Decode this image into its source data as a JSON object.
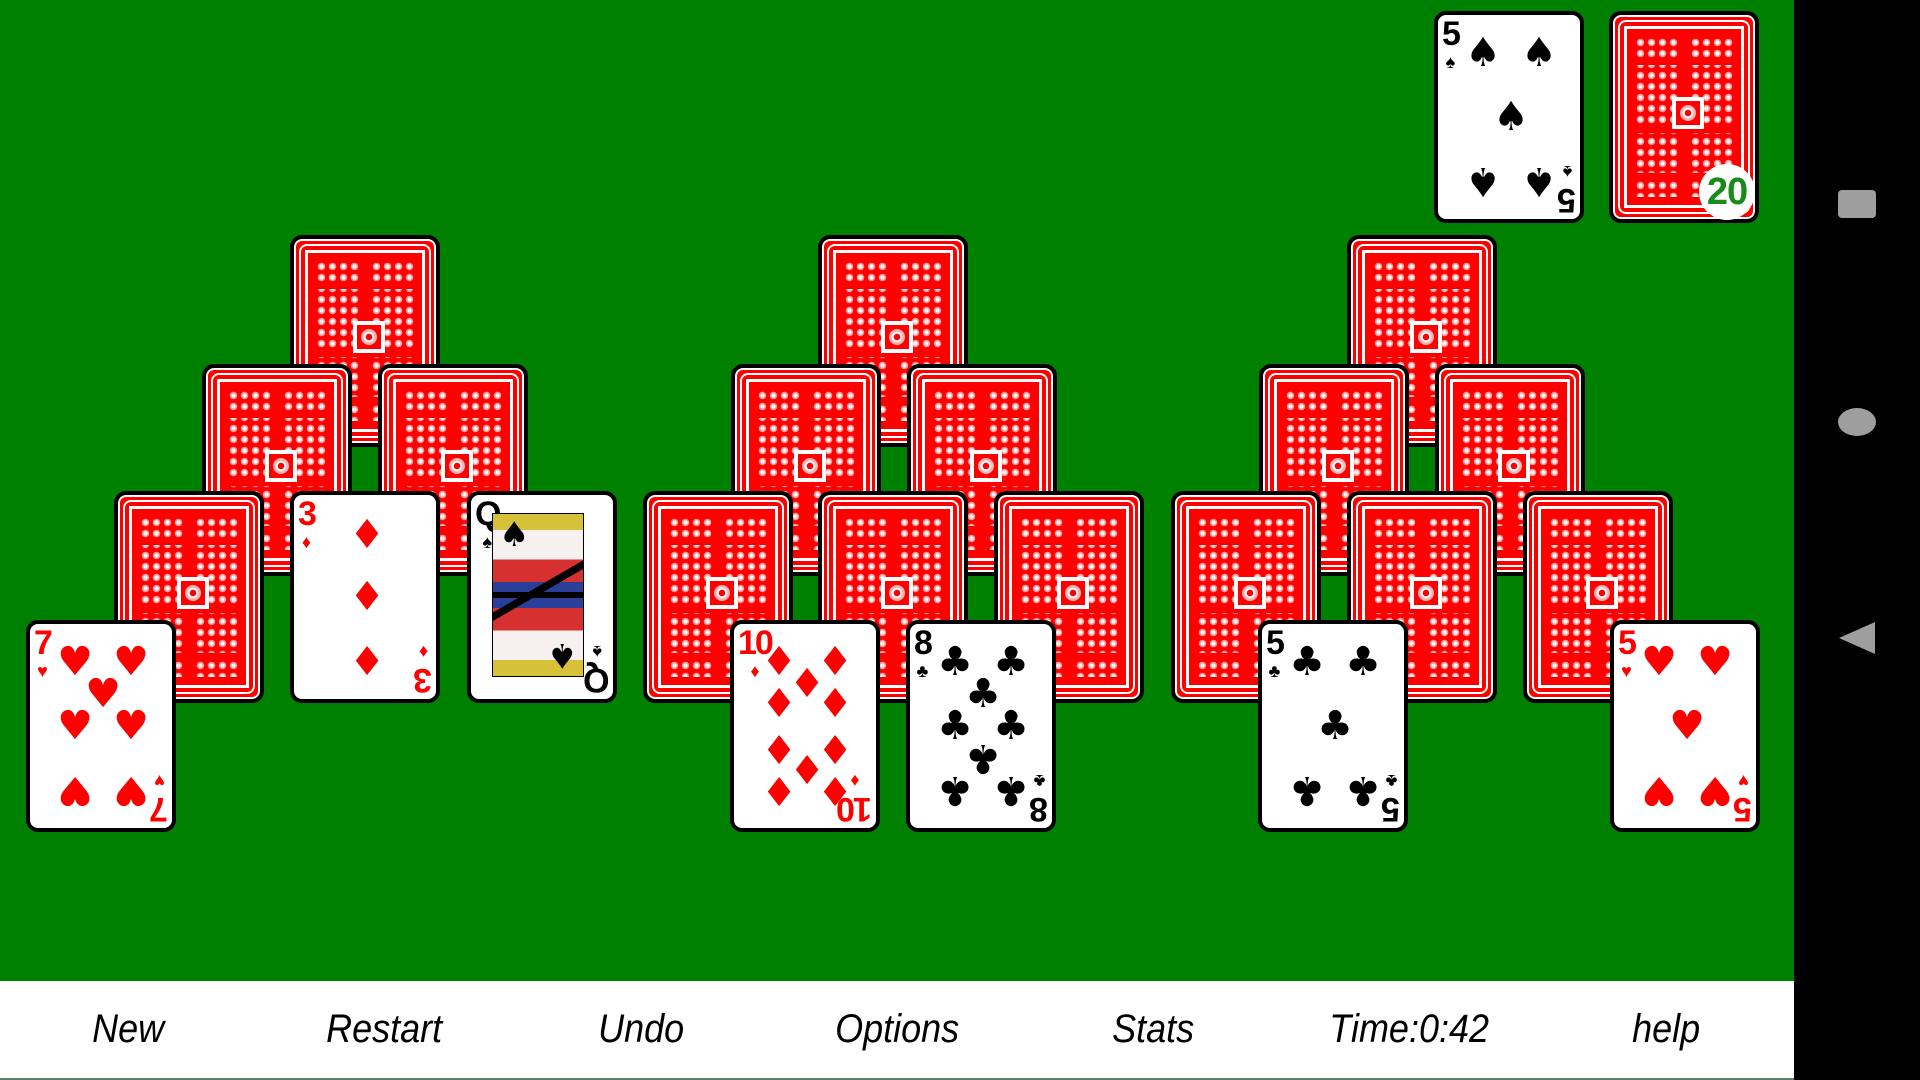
{
  "app": {
    "game": "Pyramid (Tri Peaks) Solitaire"
  },
  "colors": {
    "felt": "#008000",
    "card_back": "#ff0000",
    "red_suit": "#ff0000",
    "black_suit": "#000000",
    "badge_text": "#1a8a1a"
  },
  "waste": {
    "top_card": {
      "rank": "5",
      "suit": "spades",
      "face_up": true
    }
  },
  "stock": {
    "face_up": false,
    "remaining_count": "20"
  },
  "peaks": [
    {
      "name": "left",
      "rows": [
        [
          {
            "face_up": false
          }
        ],
        [
          {
            "face_up": false
          },
          {
            "face_up": false
          }
        ],
        [
          {
            "face_up": false
          },
          {
            "rank": "3",
            "suit": "diamonds",
            "face_up": true
          },
          {
            "rank": "Q",
            "suit": "spades",
            "face_up": true
          }
        ],
        [
          {
            "rank": "7",
            "suit": "hearts",
            "face_up": true
          }
        ]
      ]
    },
    {
      "name": "middle",
      "rows": [
        [
          {
            "face_up": false
          }
        ],
        [
          {
            "face_up": false
          },
          {
            "face_up": false
          }
        ],
        [
          {
            "face_up": false
          },
          {
            "face_up": false
          },
          {
            "face_up": false
          }
        ],
        [
          {
            "rank": "10",
            "suit": "diamonds",
            "face_up": true
          },
          {
            "rank": "8",
            "suit": "clubs",
            "face_up": true
          }
        ]
      ]
    },
    {
      "name": "right",
      "rows": [
        [
          {
            "face_up": false
          }
        ],
        [
          {
            "face_up": false
          },
          {
            "face_up": false
          }
        ],
        [
          {
            "face_up": false
          },
          {
            "face_up": false
          },
          {
            "face_up": false
          }
        ],
        [
          {
            "rank": "5",
            "suit": "clubs",
            "face_up": true
          },
          {
            "rank": "5",
            "suit": "hearts",
            "face_up": true
          }
        ]
      ]
    }
  ],
  "toolbar": {
    "new_label": "New",
    "restart_label": "Restart",
    "undo_label": "Undo",
    "options_label": "Options",
    "stats_label": "Stats",
    "time_label": "Time:0:42",
    "help_label": "help"
  },
  "navbar": {
    "icons": [
      "recents-square-icon",
      "home-circle-icon",
      "back-triangle-icon"
    ]
  }
}
